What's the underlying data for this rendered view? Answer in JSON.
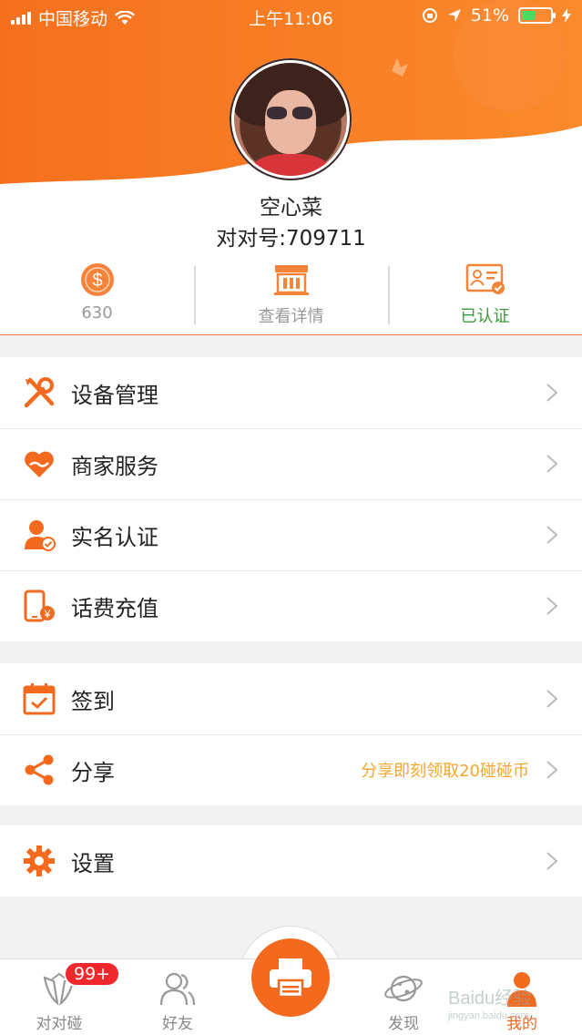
{
  "status_bar": {
    "carrier": "中国移动",
    "time": "上午11:06",
    "battery": "51%",
    "battery_level": 0.51
  },
  "profile": {
    "nickname": "空心菜",
    "account_id": "对对号:709711"
  },
  "stats": [
    {
      "icon": "coin-icon",
      "label": "630"
    },
    {
      "icon": "shop-icon",
      "label": "查看详情"
    },
    {
      "icon": "id-card-verified-icon",
      "label": "已认证"
    }
  ],
  "menu_groups": [
    [
      {
        "icon": "tools-icon",
        "label": "设备管理"
      },
      {
        "icon": "heart-hand-icon",
        "label": "商家服务"
      },
      {
        "icon": "verified-user-icon",
        "label": "实名认证"
      },
      {
        "icon": "phone-recharge-icon",
        "label": "话费充值"
      }
    ],
    [
      {
        "icon": "calendar-check-icon",
        "label": "签到"
      },
      {
        "icon": "share-icon",
        "label": "分享",
        "hint": "分享即刻领取20碰碰币"
      }
    ],
    [
      {
        "icon": "gear-icon",
        "label": "设置"
      }
    ]
  ],
  "tabbar": {
    "badge": "99+",
    "tabs": [
      {
        "icon": "bump-icon",
        "label": "对对碰",
        "active": false
      },
      {
        "icon": "friends-icon",
        "label": "好友",
        "active": false
      },
      {
        "icon": "printer-icon",
        "label": "",
        "active": false
      },
      {
        "icon": "planet-icon",
        "label": "发现",
        "active": false
      },
      {
        "icon": "person-icon",
        "label": "我的",
        "active": true
      }
    ]
  },
  "watermark": {
    "text": "Baidu经验",
    "subtext": "jingyan.baidu.com"
  },
  "colors": {
    "accent": "#f36a1f",
    "hint": "#f2a72e",
    "verified": "#3a9a3a",
    "badge": "#f0282d"
  }
}
